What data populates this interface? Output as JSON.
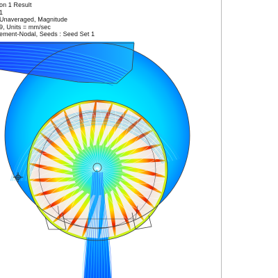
{
  "viewport": {
    "legend_lines": [
      "on 1 Result",
      "1",
      "Unaveraged, Magnitude",
      "9, Units = mm/sec",
      "ement-Nodal, Seeds : Seed Set 1"
    ]
  },
  "colors": {
    "background": "#ffffff",
    "blade": "#f2f2f2",
    "outline": "#4a4a4a",
    "fringe": [
      "#0030ff",
      "#00a0ff",
      "#00e0ff",
      "#00ff90",
      "#b0ff00",
      "#ffd000",
      "#ff7000",
      "#e00000"
    ]
  },
  "icons": [
    "crosshair-icon"
  ]
}
